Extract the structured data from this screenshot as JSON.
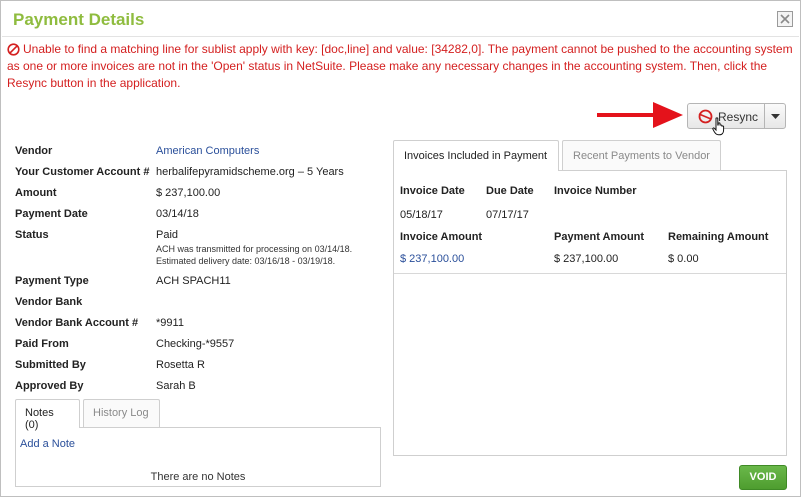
{
  "dialog": {
    "title": "Payment Details",
    "accent_color": "#8fbc3f"
  },
  "error": {
    "message": "Unable to find a matching line for sublist apply with key: [doc,line] and value: [34282,0]. The payment cannot be pushed to the accounting system as one or more invoices are not in the 'Open' status in NetSuite. Please make any necessary changes in the accounting system. Then, click the Resync button in the application.",
    "color": "#d42020"
  },
  "toolbar": {
    "resync_label": "Resync"
  },
  "details": {
    "vendor_label": "Vendor",
    "vendor_value": "American Computers",
    "customer_account_label": "Your Customer Account #",
    "customer_account_value": "herbalifepyramidscheme.org – 5 Years",
    "amount_label": "Amount",
    "amount_value": "$ 237,100.00",
    "payment_date_label": "Payment Date",
    "payment_date_value": "03/14/18",
    "status_label": "Status",
    "status_value": "Paid",
    "status_note_1": "ACH was transmitted for processing on 03/14/18.",
    "status_note_2": "Estimated delivery date: 03/16/18 - 03/19/18.",
    "payment_type_label": "Payment Type",
    "payment_type_value": "ACH SPACH11",
    "vendor_bank_label": "Vendor Bank",
    "vendor_bank_account_label": "Vendor Bank Account #",
    "vendor_bank_account_value": "*9911",
    "paid_from_label": "Paid From",
    "paid_from_value": "Checking-*9557",
    "submitted_by_label": "Submitted By",
    "submitted_by_value": "Rosetta R",
    "approved_by_label": "Approved By",
    "approved_by_value": "Sarah B"
  },
  "notes": {
    "tab_notes": "Notes (0)",
    "tab_history": "History Log",
    "add_note": "Add a Note",
    "empty": "There are no Notes"
  },
  "invoices": {
    "tab_included": "Invoices Included in Payment",
    "tab_recent": "Recent Payments to Vendor",
    "headers": {
      "invoice_date": "Invoice Date",
      "due_date": "Due Date",
      "invoice_number": "Invoice Number",
      "invoice_amount": "Invoice Amount",
      "payment_amount": "Payment Amount",
      "remaining_amount": "Remaining Amount"
    },
    "row": {
      "invoice_date": "05/18/17",
      "due_date": "07/17/17",
      "invoice_number": "",
      "invoice_amount": "$ 237,100.00",
      "payment_amount": "$ 237,100.00",
      "remaining_amount": "$ 0.00"
    }
  },
  "footer": {
    "void_label": "VOID",
    "void_color": "#5aa83b"
  },
  "icons": {
    "close": "close-icon",
    "error": "prohibited-icon",
    "resync": "sync-icon",
    "caret": "chevron-down-icon",
    "arrow": "red-arrow-icon",
    "cursor": "hand-cursor-icon"
  }
}
